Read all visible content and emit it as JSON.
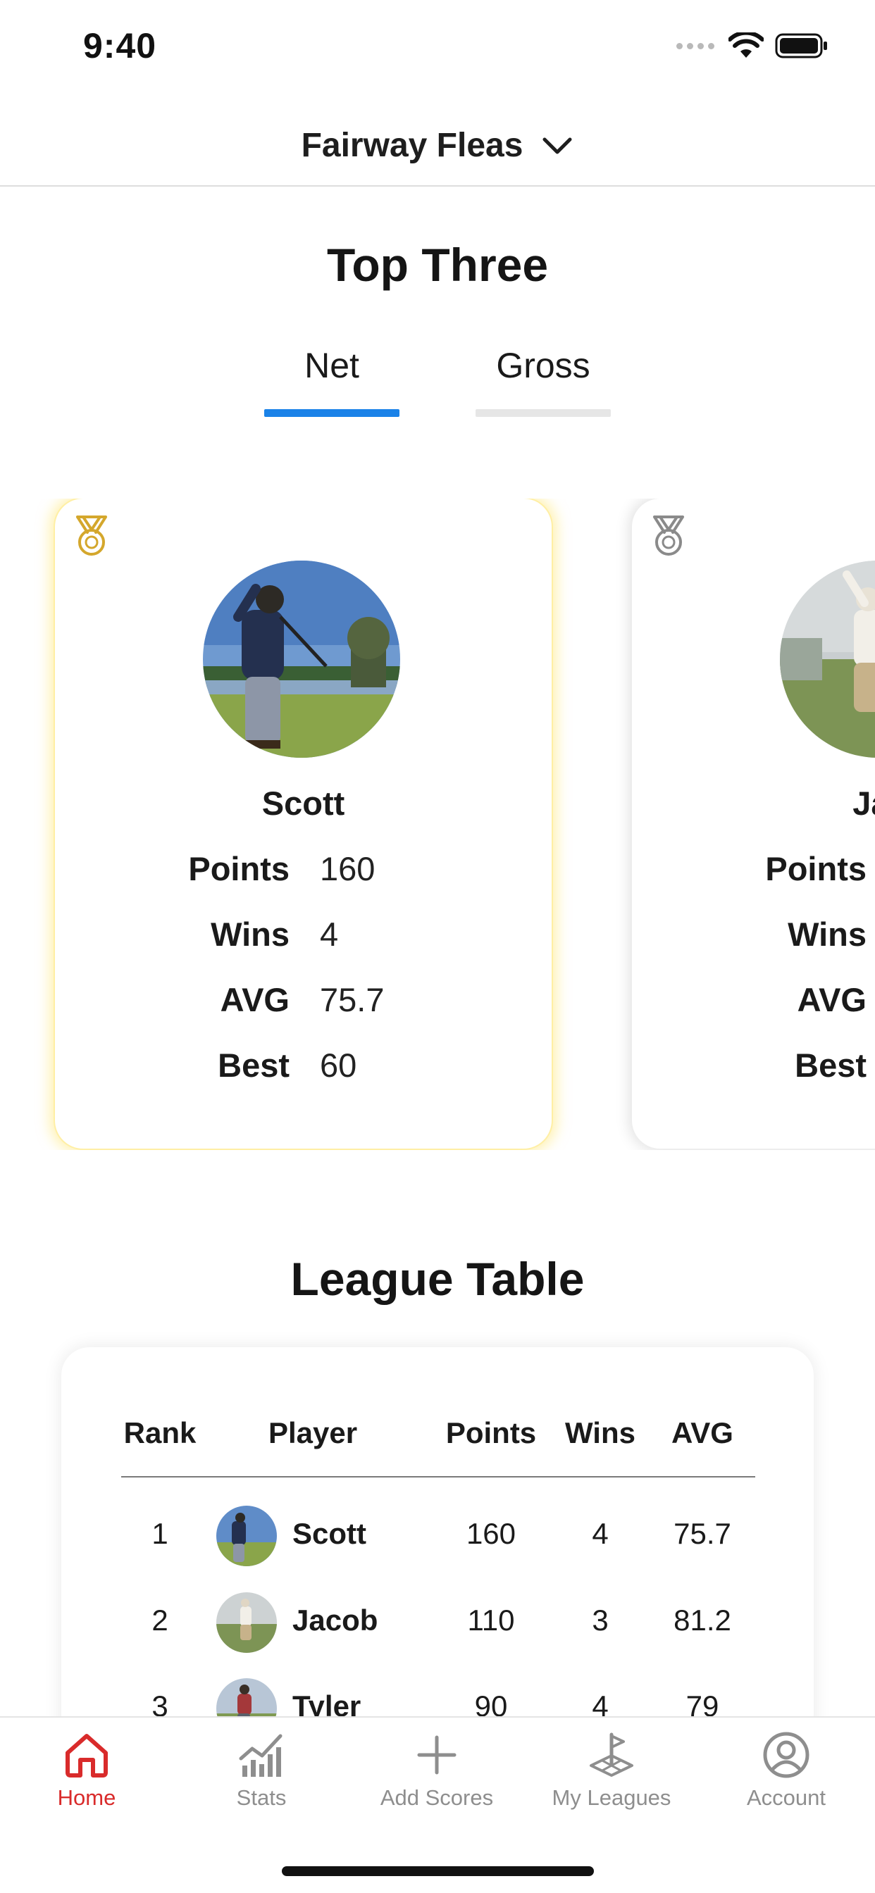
{
  "status_bar": {
    "time": "9:40"
  },
  "header": {
    "league_name": "Fairway Fleas"
  },
  "top_three": {
    "title": "Top Three",
    "tabs": [
      {
        "label": "Net",
        "active": true
      },
      {
        "label": "Gross",
        "active": false
      }
    ],
    "cards": [
      {
        "rank_medal": "gold-medal-icon",
        "name": "Scott",
        "stats": [
          {
            "label": "Points",
            "value": "160"
          },
          {
            "label": "Wins",
            "value": "4"
          },
          {
            "label": "AVG",
            "value": "75.7"
          },
          {
            "label": "Best",
            "value": "60"
          }
        ]
      },
      {
        "rank_medal": "silver-medal-icon",
        "name": "Jac",
        "stats": [
          {
            "label": "Points",
            "value": ""
          },
          {
            "label": "Wins",
            "value": ""
          },
          {
            "label": "AVG",
            "value": ""
          },
          {
            "label": "Best",
            "value": ""
          }
        ]
      }
    ]
  },
  "league_table": {
    "title": "League Table",
    "columns": [
      "Rank",
      "Player",
      "Points",
      "Wins",
      "AVG"
    ],
    "rows": [
      {
        "rank": "1",
        "player": "Scott",
        "points": "160",
        "wins": "4",
        "avg": "75.7"
      },
      {
        "rank": "2",
        "player": "Jacob",
        "points": "110",
        "wins": "3",
        "avg": "81.2"
      },
      {
        "rank": "3",
        "player": "Tyler",
        "points": "90",
        "wins": "4",
        "avg": "79"
      }
    ]
  },
  "bottom_nav": [
    {
      "label": "Home",
      "icon": "home-icon",
      "active": true
    },
    {
      "label": "Stats",
      "icon": "stats-chart-icon",
      "active": false
    },
    {
      "label": "Add Scores",
      "icon": "plus-icon",
      "active": false
    },
    {
      "label": "My Leagues",
      "icon": "golf-flag-icon",
      "active": false
    },
    {
      "label": "Account",
      "icon": "account-icon",
      "active": false
    }
  ],
  "colors": {
    "accent_blue": "#1a82e8",
    "active_nav_red": "#d92b2b",
    "gold": "#d4a72c",
    "silver": "#8a8a8a"
  }
}
